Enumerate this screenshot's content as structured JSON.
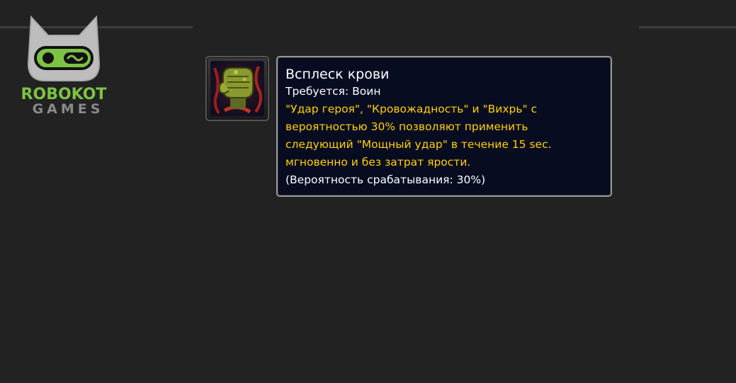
{
  "logo": {
    "line1": "ROBOKOT",
    "line2": "GAMES",
    "icon": "robot-cat-icon",
    "colors": {
      "green": "#7dc242",
      "gray": "#8a8a8a",
      "head": "#bdbdbd"
    }
  },
  "ability": {
    "icon": "bloody-fist-icon",
    "name": "Всплеск крови",
    "requirement": "Требуется: Воин",
    "description_lines": [
      "\"Удар героя\", \"Кровожадность\" и \"Вихрь\" с",
      "вероятностью 30% позволяют применить",
      "следующий \"Мощный удар\" в течение 15 sec.",
      "мгновенно и без затрат ярости."
    ],
    "proc_chance": "(Вероятность срабатывания: 30%)"
  },
  "colors": {
    "background": "#222222",
    "tooltip_bg": "#080c21",
    "tooltip_border": "#9a9a9a",
    "title_text": "#ffffff",
    "description_text": "#ffd100"
  }
}
